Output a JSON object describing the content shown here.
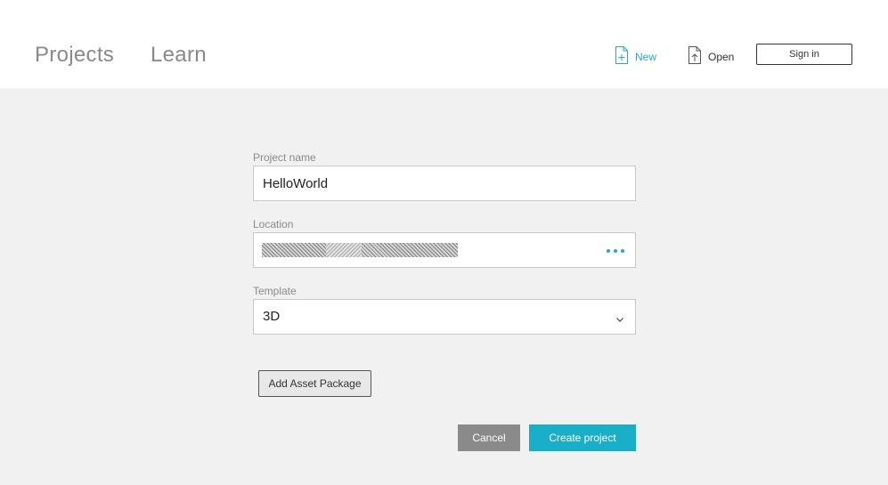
{
  "nav": {
    "tabs": [
      {
        "label": "Projects"
      },
      {
        "label": "Learn"
      }
    ]
  },
  "header_actions": {
    "new": {
      "label": "New",
      "icon": "new-file-icon",
      "color": "#26a9c8"
    },
    "open": {
      "label": "Open",
      "icon": "open-file-icon"
    },
    "signin": {
      "label": "Sign in"
    }
  },
  "form": {
    "project_name": {
      "label": "Project name",
      "value": "HelloWorld"
    },
    "location": {
      "label": "Location",
      "browse_icon": "ellipsis-icon"
    },
    "template": {
      "label": "Template",
      "value": "3D",
      "icon": "chevron-down-icon"
    },
    "add_asset_package": {
      "label": "Add Asset Package"
    },
    "cancel": {
      "label": "Cancel"
    },
    "create": {
      "label": "Create project",
      "color": "#19aec8"
    }
  }
}
